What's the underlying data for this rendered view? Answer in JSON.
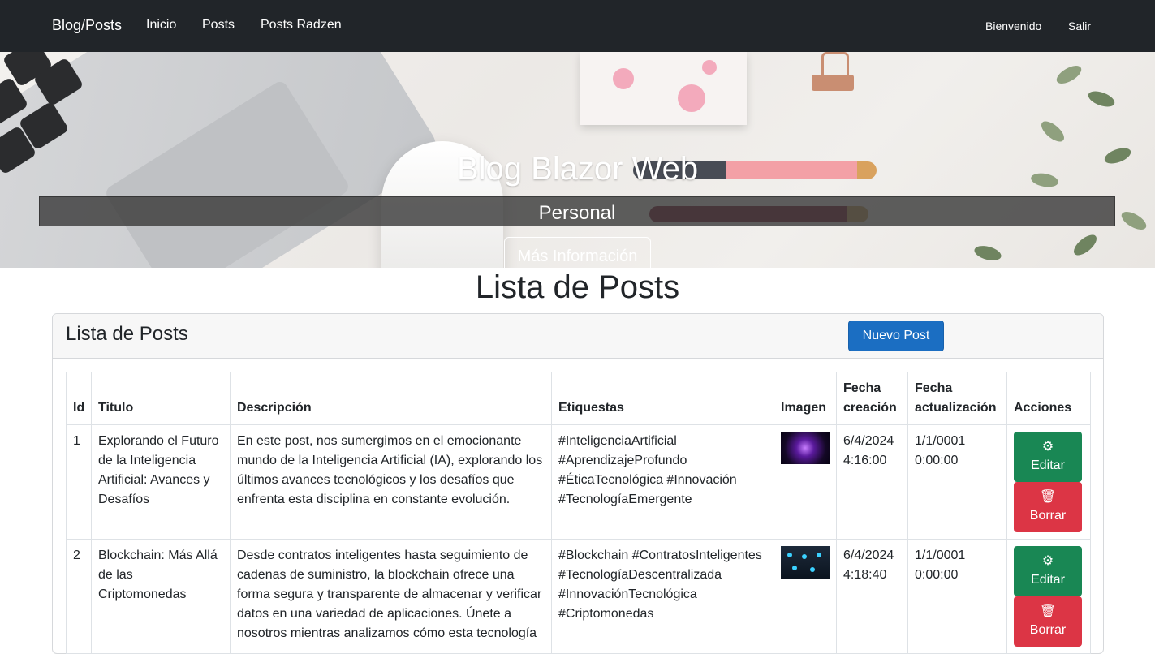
{
  "navbar": {
    "brand": "Blog/Posts",
    "links": [
      "Inicio",
      "Posts",
      "Posts Radzen"
    ],
    "welcome": "Bienvenido",
    "logout": "Salir"
  },
  "hero": {
    "title": "Blog Blazor Web",
    "subtitle": "Personal",
    "button": "Más Información"
  },
  "page_title": "Lista de Posts",
  "card": {
    "title": "Lista de Posts",
    "new_button": "Nuevo Post"
  },
  "table": {
    "headers": {
      "id": "Id",
      "titulo": "Titulo",
      "descripcion": "Descripción",
      "etiquetas": "Etiquestas",
      "imagen": "Imagen",
      "fecha_creacion": "Fecha creación",
      "fecha_actualizacion": "Fecha actualización",
      "acciones": "Acciones"
    },
    "rows": [
      {
        "id": "1",
        "titulo": "Explorando el Futuro de la Inteligencia Artificial: Avances y Desafíos",
        "descripcion": "En este post, nos sumergimos en el emocionante mundo de la Inteligencia Artificial (IA), explorando los últimos avances tecnológicos y los desafíos que enfrenta esta disciplina en constante evolución.",
        "etiquetas": "#InteligenciaArtificial #AprendizajeProfundo #ÉticaTecnológica #Innovación #TecnologíaEmergente",
        "fecha_creacion": "6/4/2024 4:16:00",
        "fecha_actualizacion": "1/1/0001 0:00:00",
        "edit_label": "Editar",
        "delete_label": "Borrar"
      },
      {
        "id": "2",
        "titulo": "Blockchain: Más Allá de las Criptomonedas",
        "descripcion": "Desde contratos inteligentes hasta seguimiento de cadenas de suministro, la blockchain ofrece una forma segura y transparente de almacenar y verificar datos en una variedad de aplicaciones. Únete a nosotros mientras analizamos cómo esta tecnología",
        "etiquetas": "#Blockchain #ContratosInteligentes #TecnologíaDescentralizada #InnovaciónTecnológica #Criptomonedas",
        "fecha_creacion": "6/4/2024 4:18:40",
        "fecha_actualizacion": "1/1/0001 0:00:00",
        "edit_label": "Editar",
        "delete_label": "Borrar"
      }
    ]
  },
  "icons": {
    "edit": "gear-icon",
    "delete": "trash-icon"
  },
  "colors": {
    "navbar": "#212529",
    "primary": "#1b6ec2",
    "success": "#198754",
    "danger": "#dc3545"
  }
}
